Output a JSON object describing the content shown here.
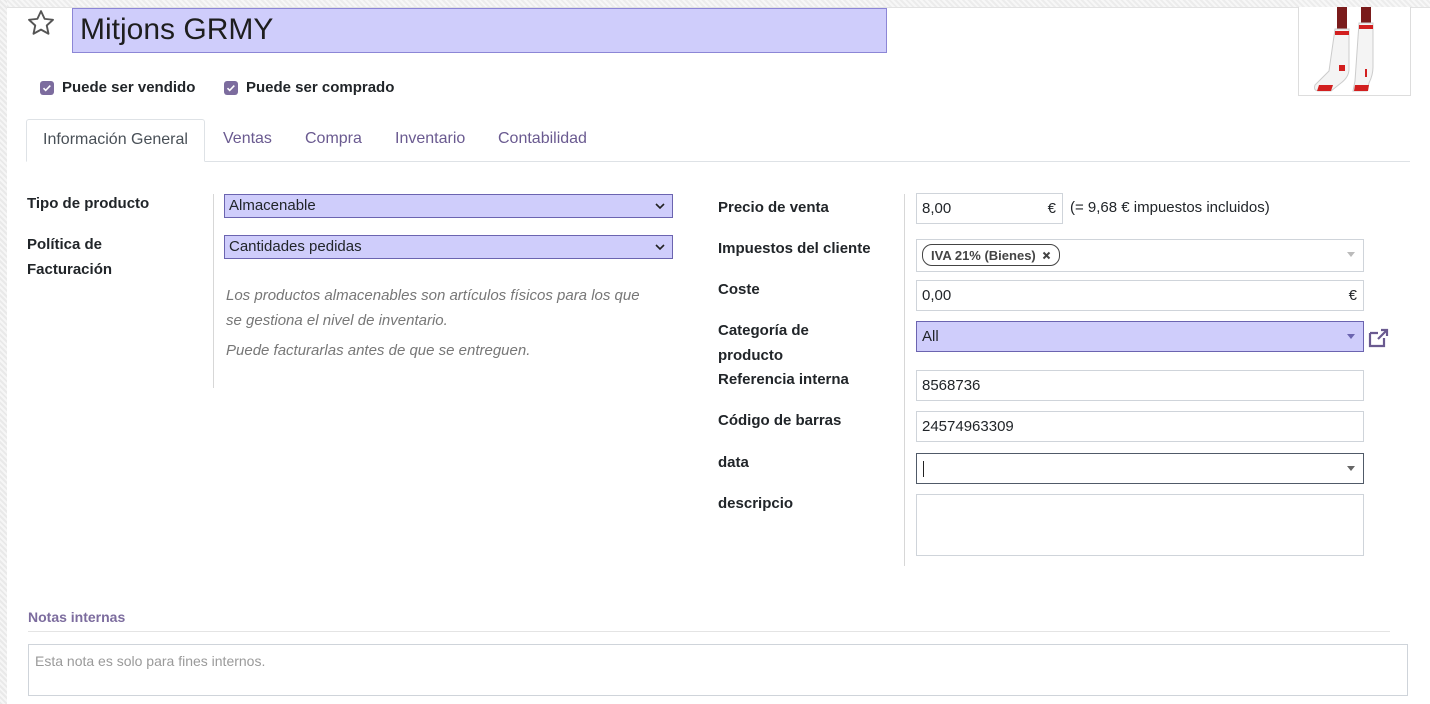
{
  "product": {
    "name": "Mitjons GRMY",
    "image_alt": "socks-product-image"
  },
  "checkboxes": {
    "sold_label": "Puede ser vendido",
    "sold_checked": true,
    "purchased_label": "Puede ser comprado",
    "purchased_checked": true
  },
  "tabs": [
    {
      "label": "Información General",
      "active": true
    },
    {
      "label": "Ventas",
      "active": false
    },
    {
      "label": "Compra",
      "active": false
    },
    {
      "label": "Inventario",
      "active": false
    },
    {
      "label": "Contabilidad",
      "active": false
    }
  ],
  "left_fields": {
    "product_type_label": "Tipo de producto",
    "product_type_value": "Almacenable",
    "invoicing_policy_label_1": "Política de",
    "invoicing_policy_label_2": "Facturación",
    "invoicing_policy_value": "Cantidades pedidas",
    "help_line_1": "Los productos almacenables son artículos físicos para los que",
    "help_line_2": "se gestiona el nivel de inventario.",
    "help_line_3": "Puede facturarlas antes de que se entreguen."
  },
  "right_fields": {
    "sale_price_label": "Precio de venta",
    "sale_price_value": "8,00",
    "currency_symbol": "€",
    "tax_included_note": "(= 9,68 € impuestos incluidos)",
    "customer_taxes_label": "Impuestos del cliente",
    "customer_tax_tag": "IVA 21% (Bienes)",
    "cost_label": "Coste",
    "cost_value": "0,00",
    "category_label_1": "Categoría de",
    "category_label_2": "producto",
    "category_value": "All",
    "internal_ref_label": "Referencia interna",
    "internal_ref_value": "8568736",
    "barcode_label": "Código de barras",
    "barcode_value": "24574963309",
    "data_label": "data",
    "data_value": "",
    "descripcio_label": "descripcio",
    "descripcio_value": ""
  },
  "notes": {
    "title": "Notas internas",
    "placeholder": "Esta nota es solo para fines internos."
  },
  "colors": {
    "highlight": "#cfcdfb",
    "accent": "#7c6c9e"
  }
}
